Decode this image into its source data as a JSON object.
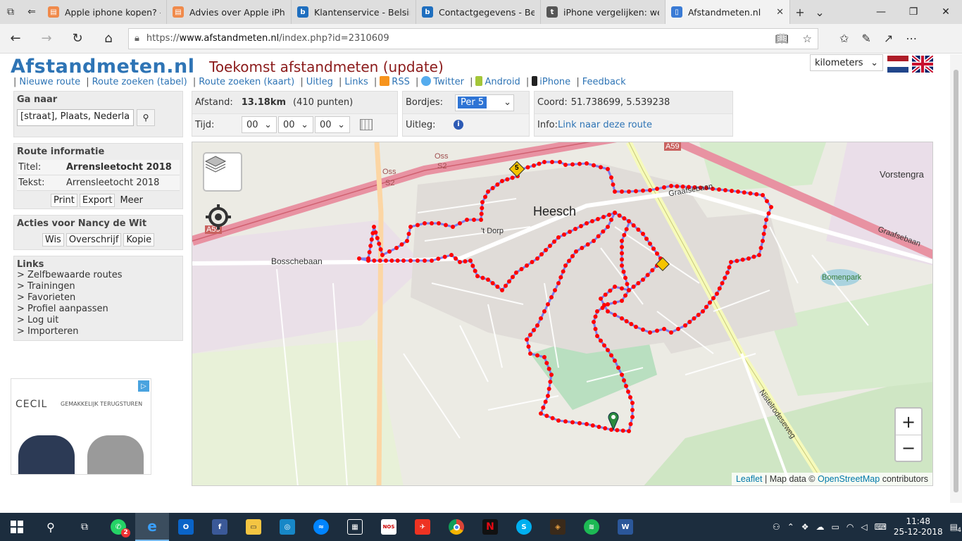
{
  "browser": {
    "tabs": [
      {
        "label": "Apple iphone kopen? -",
        "color": "#f08a4b",
        "glyph": "▤"
      },
      {
        "label": "Advies over Apple iPho",
        "color": "#f08a4b",
        "glyph": "▤"
      },
      {
        "label": "Klantenservice - Belsim",
        "color": "#1f6fbf",
        "glyph": "b"
      },
      {
        "label": "Contactgegevens - Bels",
        "color": "#1f6fbf",
        "glyph": "b"
      },
      {
        "label": "iPhone vergelijken: wel",
        "color": "#555555",
        "glyph": "t"
      },
      {
        "label": "Afstandmeten.nl",
        "color": "#3a7bd5",
        "glyph": "▯"
      }
    ],
    "url_prefix": "https://",
    "url_host": "www.afstandmeten.nl",
    "url_path": "/index.php?id=2310609"
  },
  "site": {
    "logo": "Afstandmeten.nl",
    "headline": "Toekomst afstandmeten (update)",
    "unit_select": "kilometers",
    "nav": [
      {
        "label": "Nieuwe route"
      },
      {
        "label": "Route zoeken (tabel)"
      },
      {
        "label": "Route zoeken (kaart)"
      },
      {
        "label": "Uitleg"
      },
      {
        "label": "Links"
      },
      {
        "label": "RSS"
      },
      {
        "label": "Twitter"
      },
      {
        "label": "Android"
      },
      {
        "label": "iPhone"
      },
      {
        "label": "Feedback"
      }
    ]
  },
  "sidebar": {
    "goto_title": "Ga naar",
    "goto_value": "[straat], Plaats, Nederla",
    "route_info_title": "Route informatie",
    "titel_label": "Titel:",
    "titel_value": "Arrensleetocht 2018",
    "tekst_label": "Tekst:",
    "tekst_value": "Arrensleetocht 2018",
    "print": "Print",
    "export": "Export",
    "meer": "Meer",
    "actions_title": "Acties voor Nancy de Wit",
    "wis": "Wis",
    "overschrijf": "Overschrijf",
    "kopie": "Kopie",
    "links_title": "Links",
    "links": [
      "> Zelfbewaarde routes",
      "> Trainingen",
      "> Favorieten",
      "> Profiel aanpassen",
      "> Log uit",
      "> Importeren"
    ]
  },
  "ad": {
    "brand": "CECIL",
    "tagline": "GEMAKKELIJK TERUGSTUREN"
  },
  "infobar": {
    "afstand_label": "Afstand:",
    "afstand_value": "13.18km",
    "punten": "(410 punten)",
    "tijd_label": "Tijd:",
    "hh": "00",
    "mm": "00",
    "ss": "00",
    "bordjes_label": "Bordjes:",
    "bordjes_value": "Per 5",
    "uitleg_label": "Uitleg:",
    "coord_label": "Coord:",
    "coord_value": "51.738699, 5.539238",
    "info_label": "Info:",
    "info_link": "Link naar deze route"
  },
  "map": {
    "labels": {
      "town": "Heesch",
      "bosschebaan": "Bosschebaan",
      "graafsebaan": "Graafsebaan",
      "graafsebaan2": "Graafsebaan",
      "bomenpark": "Bomenpark",
      "vorstengr": "Vorstengra",
      "oss": "Oss",
      "oss2": "Oss",
      "s52a": "S2",
      "s52b": "S2",
      "a59": "A59",
      "a59b": "A59",
      "tdorp": "'t Dorp",
      "nistelrode": "Nistelrodeseweg"
    },
    "markers": {
      "km5": "5"
    },
    "zoom_in": "+",
    "zoom_out": "−",
    "attrib_leaflet": "Leaflet",
    "attrib_mid": " | Map data © ",
    "attrib_osm": "OpenStreetMap",
    "attrib_end": " contributors"
  },
  "taskbar": {
    "time": "11:48",
    "date": "25-12-2018",
    "notifications": "4",
    "whatsapp_badge": "2"
  },
  "colors": {
    "route_line": "#6b6bf0",
    "route_point": "#ff0000",
    "logo": "#2e74b5",
    "headline": "#8b1a1a"
  }
}
